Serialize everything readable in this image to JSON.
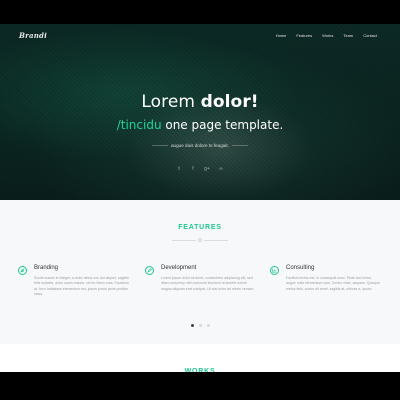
{
  "nav": {
    "logo": "Brandi",
    "tagline": "",
    "menu": [
      "Home",
      "Features",
      "Works",
      "Team",
      "Contact"
    ]
  },
  "hero": {
    "headline_regular": "Lorem ",
    "headline_bold": "dolor!",
    "subline_accent": "/tincidu",
    "subline_rest": " one page template.",
    "small_text": "augue duis dolore te feugait.",
    "socials": [
      {
        "icon": "twitter-icon",
        "glyph": "𝕥"
      },
      {
        "icon": "facebook-icon",
        "glyph": "f"
      },
      {
        "icon": "google-plus-icon",
        "glyph": "g+"
      },
      {
        "icon": "flickr-icon",
        "glyph": "∞"
      }
    ]
  },
  "features": {
    "title": "FEATURES",
    "items": [
      {
        "title": "Branding",
        "text": "Sociis mauris in integer, a dolor netus non dui aliquet, sagittis felis sodales, dolor sociis mauris, vel eu libero cras. Faucibus at. Arcu habitasse elementum est, ipsum purus pede porttitor class.",
        "icon": "leaf-icon"
      },
      {
        "title": "Development",
        "text": "Lorem ipsum dolor sit amet, consectetur adipiscing elit, sed diam nonummy nibh euismod tincidunt ut laoreet dolore magna aliquam erat volutpat. Ut wisi enim ad minim veniam.",
        "icon": "pencil-icon"
      },
      {
        "title": "Consulting",
        "text": "Facilisis lectus est. In consequat nunc. Pede sed lorem, augue nulla elementum nam. Donec vitae, aliquam. Quisque metus felis, auctor sit amet, sagittis at, ultrices a, ipsum.",
        "icon": "chart-icon"
      }
    ],
    "carousel_active": 0,
    "carousel_count": 3
  },
  "works": {
    "title": "WORKS"
  },
  "colors": {
    "accent": "#1ec68f",
    "hero_bg": "#0b2420",
    "features_bg": "#f7f8f9"
  }
}
